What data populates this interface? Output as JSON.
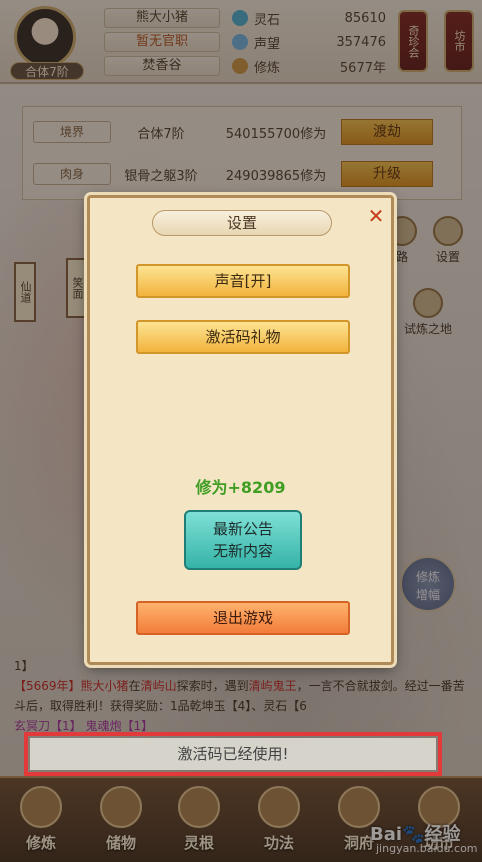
{
  "header": {
    "avatar_level": "合体7阶",
    "player_name": "熊大小猪",
    "official_rank": "暂无官职",
    "sect": "焚香谷",
    "resources": [
      {
        "label": "灵石",
        "value": "85610",
        "icon": "spirit-stone-icon",
        "color": "#45a9d2"
      },
      {
        "label": "声望",
        "value": "357476",
        "icon": "reputation-icon",
        "color": "#6bb0e0"
      },
      {
        "label": "修炼",
        "value": "5677年",
        "icon": "cultivation-icon",
        "color": "#c7903f"
      }
    ],
    "side_buttons": [
      "奇珍会",
      "坊市"
    ]
  },
  "realm_panel": {
    "rows": [
      {
        "tag": "境界",
        "value": "合体7阶",
        "number": "540155700修为",
        "button": "渡劫"
      },
      {
        "tag": "肉身",
        "value": "银骨之躯3阶",
        "number": "249039865修为",
        "button": "升级"
      }
    ]
  },
  "scene": {
    "right_icons": [
      "路",
      "设置",
      "试炼之地"
    ],
    "banners": [
      "仙道",
      "笑面"
    ],
    "lotus": "修炼\n增幅"
  },
  "modal": {
    "title": "设置",
    "close": "✕",
    "buttons": [
      "声音[开]",
      "激活码礼物"
    ],
    "xiuwei": "修为+8209",
    "notice_line1": "最新公告",
    "notice_line2": "无新内容",
    "exit": "退出游戏"
  },
  "log": {
    "line0": "1】",
    "year": "【5669年】",
    "name": "熊大小猪",
    "t1": "在",
    "place": "清屿山",
    "t2": "探索时，遇到",
    "enemy": "清屿鬼王",
    "t3": "，一言不合就拔剑。经过一番苦斗后，取得胜利！获得奖励：1品乾坤玉【4】、灵石【6",
    "item1": "玄冥刀【1】",
    "item2": "鬼魂炮【1】"
  },
  "toast": "激活码已经使用!",
  "bottom_nav": [
    "修炼",
    "储物",
    "灵根",
    "功法",
    "洞府",
    "坊市"
  ],
  "watermark": {
    "brand": "Bai🐾经验",
    "url": "jingyan.baidu.com"
  }
}
